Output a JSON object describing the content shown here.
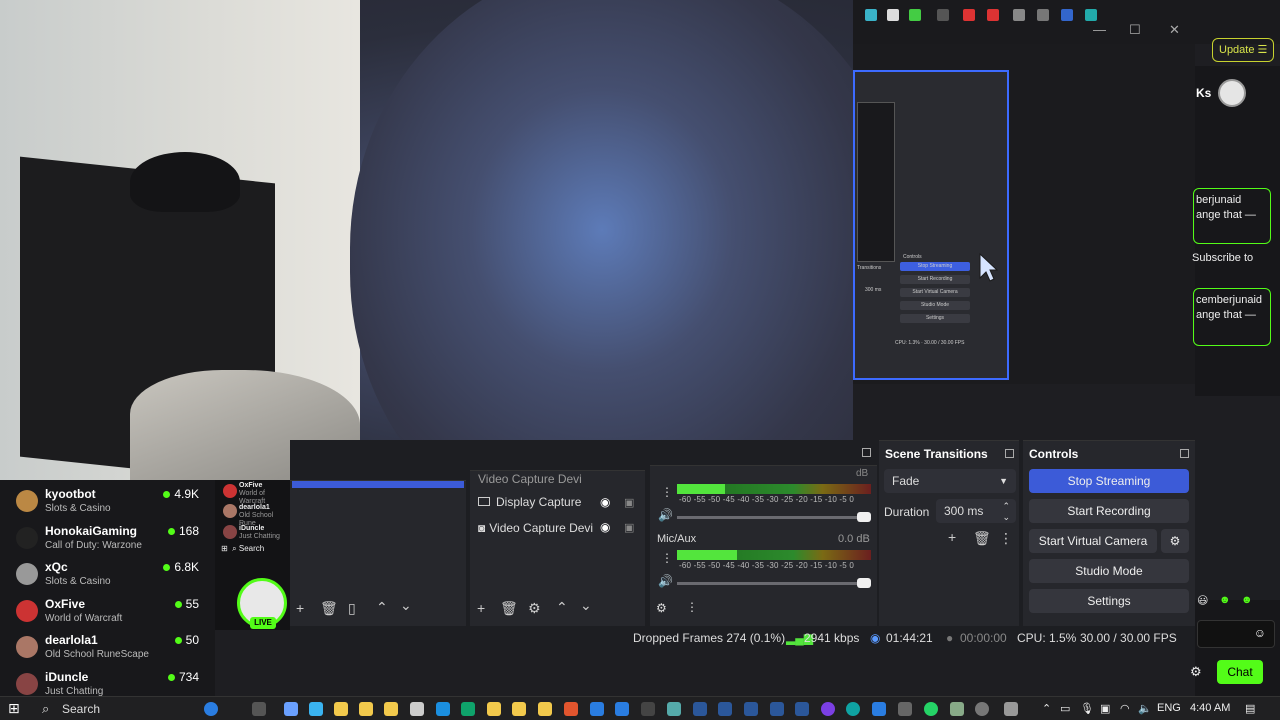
{
  "right_top": {
    "update_label": "Update",
    "ks_label": "Ks",
    "messages": [
      {
        "line1": "berjunaid",
        "line2": "ange that —"
      },
      {
        "line1": "cemberjunaid",
        "line2": "ange that —"
      }
    ],
    "subscribe_text": "Subscribe to"
  },
  "preview_mini": {
    "stop_streaming": "Stop Streaming",
    "start_recording": "Start Recording",
    "start_virtual_camera": "Start Virtual Camera",
    "studio_mode": "Studio Mode",
    "settings": "Settings",
    "scene_transitions": "Transitions",
    "controls": "Controls",
    "duration": "300 ms",
    "status": "CPU: 1.3% · 30.00 / 30.00 FPS"
  },
  "sources": {
    "items": [
      {
        "label": "Video Capture Devi"
      },
      {
        "label": "Display Capture"
      },
      {
        "label": "Video Capture Devi"
      }
    ]
  },
  "audio_mixer": {
    "top_db": "dB",
    "scale": "-60 -55 -50 -45 -40 -35 -30 -25 -20 -15 -10 -5 0",
    "mic_label": "Mic/Aux",
    "mic_db": "0.0 dB"
  },
  "scene_transitions": {
    "title": "Scene Transitions",
    "transition": "Fade",
    "duration_label": "Duration",
    "duration_value": "300 ms"
  },
  "controls": {
    "title": "Controls",
    "stop_streaming": "Stop Streaming",
    "start_recording": "Start Recording",
    "start_virtual_camera": "Start Virtual Camera",
    "studio_mode": "Studio Mode",
    "settings": "Settings",
    "accent": "#3c5bd8"
  },
  "status_bar": {
    "dropped_frames": "Dropped Frames 274 (0.1%)",
    "bitrate": "2941 kbps",
    "stream_time": "01:44:21",
    "rec_time": "00:00:00",
    "cpu": "CPU: 1.5%",
    "fps": "30.00 / 30.00 FPS"
  },
  "streams": [
    {
      "name": "kyootbot",
      "game": "Slots & Casino",
      "count": "4.9K",
      "color": "#b84"
    },
    {
      "name": "HonokaiGaming",
      "game": "Call of Duty: Warzone",
      "count": "168",
      "color": "#222"
    },
    {
      "name": "xQc",
      "game": "Slots & Casino",
      "count": "6.8K",
      "color": "#999"
    },
    {
      "name": "OxFive",
      "game": "World of Warcraft",
      "count": "55",
      "color": "#c33"
    },
    {
      "name": "dearlola1",
      "game": "Old School RuneScape",
      "count": "50",
      "color": "#a76"
    },
    {
      "name": "iDuncle",
      "game": "Just Chatting",
      "count": "734",
      "color": "#844"
    }
  ],
  "mini_streams": [
    {
      "name": "OxFive",
      "game": "World of Warcraft"
    },
    {
      "name": "dearlola1",
      "game": "Old School Rune"
    },
    {
      "name": "iDuncle",
      "game": "Just Chatting"
    }
  ],
  "mini_search": "Search",
  "live_label": "LIVE",
  "chat_button": "Chat",
  "taskbar": {
    "search": "Search",
    "lang": "ENG",
    "time": "4:40 AM"
  }
}
